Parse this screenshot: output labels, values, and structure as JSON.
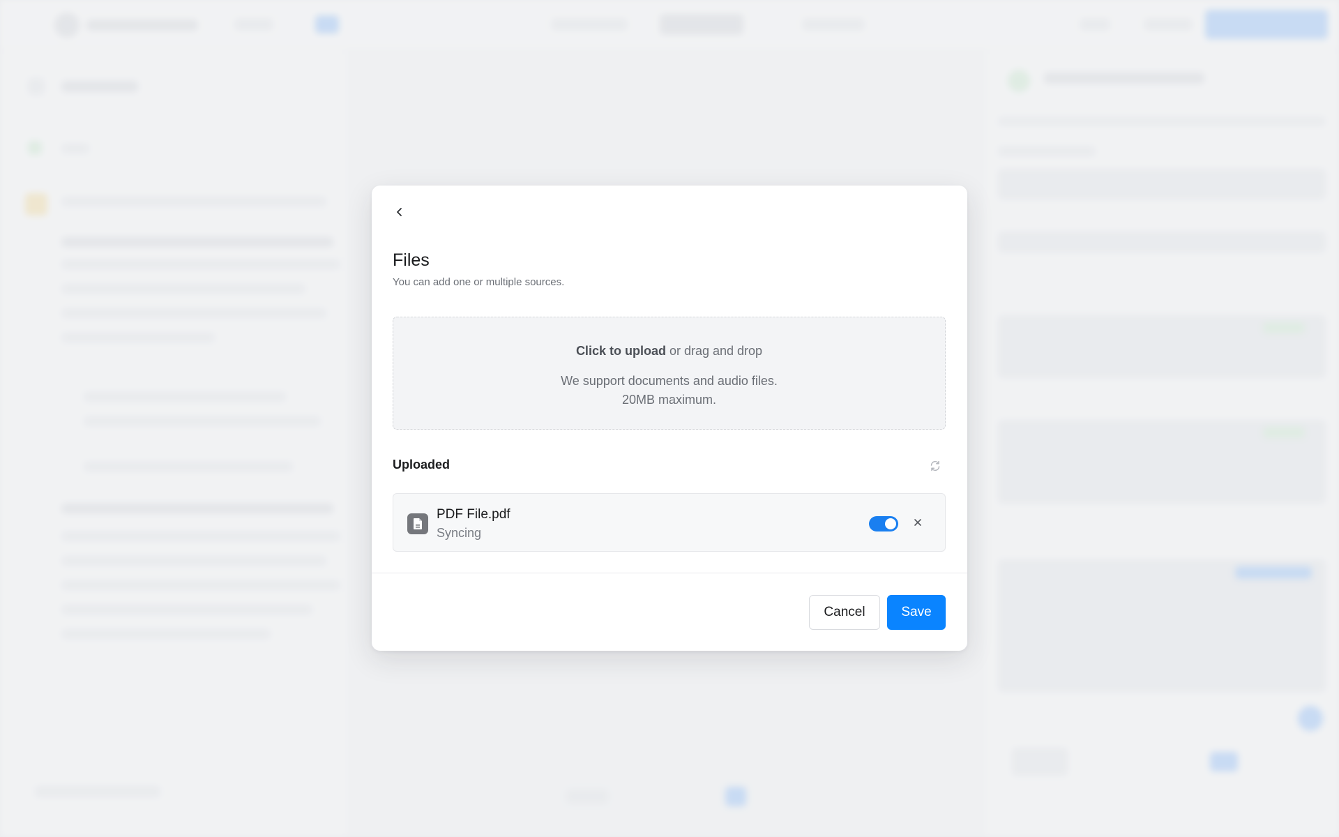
{
  "modal": {
    "title": "Files",
    "subtitle": "You can add one or multiple sources.",
    "dropzone": {
      "action_label": "Click to upload",
      "action_suffix": " or drag and drop",
      "support_text": "We support documents and audio files.",
      "limit_text": "20MB maximum."
    },
    "uploaded_heading": "Uploaded",
    "files": [
      {
        "name": "PDF File.pdf",
        "status": "Syncing",
        "enabled": true
      }
    ],
    "buttons": {
      "cancel": "Cancel",
      "save": "Save"
    }
  },
  "icons": {
    "back": "chevron-left-icon",
    "refresh": "refresh-icon",
    "file": "document-icon",
    "remove": "close-icon"
  },
  "colors": {
    "accent": "#0a84ff",
    "toggle_on": "#1a7ff0"
  }
}
